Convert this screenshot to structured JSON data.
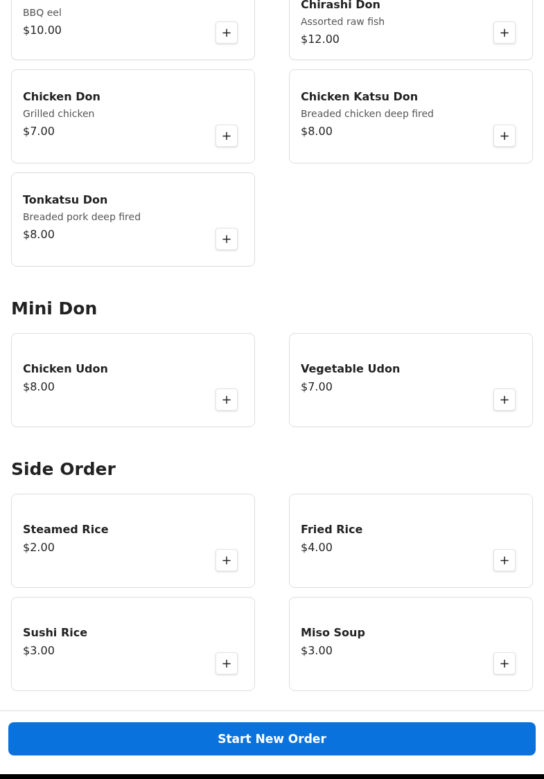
{
  "sections": [
    {
      "clipped": true,
      "items": [
        {
          "description": "BBQ eel",
          "price": "$10.00",
          "add": "+"
        },
        {
          "name": "Chirashi Don",
          "description": "Assorted raw fish",
          "price": "$12.00",
          "add": "+"
        }
      ]
    },
    {
      "clipped": false,
      "items": [
        {
          "name": "Chicken Don",
          "description": "Grilled chicken",
          "price": "$7.00",
          "add": "+"
        },
        {
          "name": "Chicken Katsu Don",
          "description": "Breaded chicken deep fired",
          "price": "$8.00",
          "add": "+"
        },
        {
          "name": "Tonkatsu Don",
          "description": "Breaded pork deep fired",
          "price": "$8.00",
          "add": "+"
        }
      ]
    },
    {
      "heading": "Mini Don",
      "clipped": false,
      "items": [
        {
          "name": "Chicken Udon",
          "price": "$8.00",
          "add": "+"
        },
        {
          "name": "Vegetable Udon",
          "price": "$7.00",
          "add": "+"
        }
      ]
    },
    {
      "heading": "Side Order",
      "clipped": false,
      "items": [
        {
          "name": "Steamed Rice",
          "price": "$2.00",
          "add": "+"
        },
        {
          "name": "Fried Rice",
          "price": "$4.00",
          "add": "+"
        },
        {
          "name": "Sushi Rice",
          "price": "$3.00",
          "add": "+"
        },
        {
          "name": "Miso Soup",
          "price": "$3.00",
          "add": "+"
        }
      ]
    }
  ],
  "footer": {
    "button": "Start New Order"
  }
}
